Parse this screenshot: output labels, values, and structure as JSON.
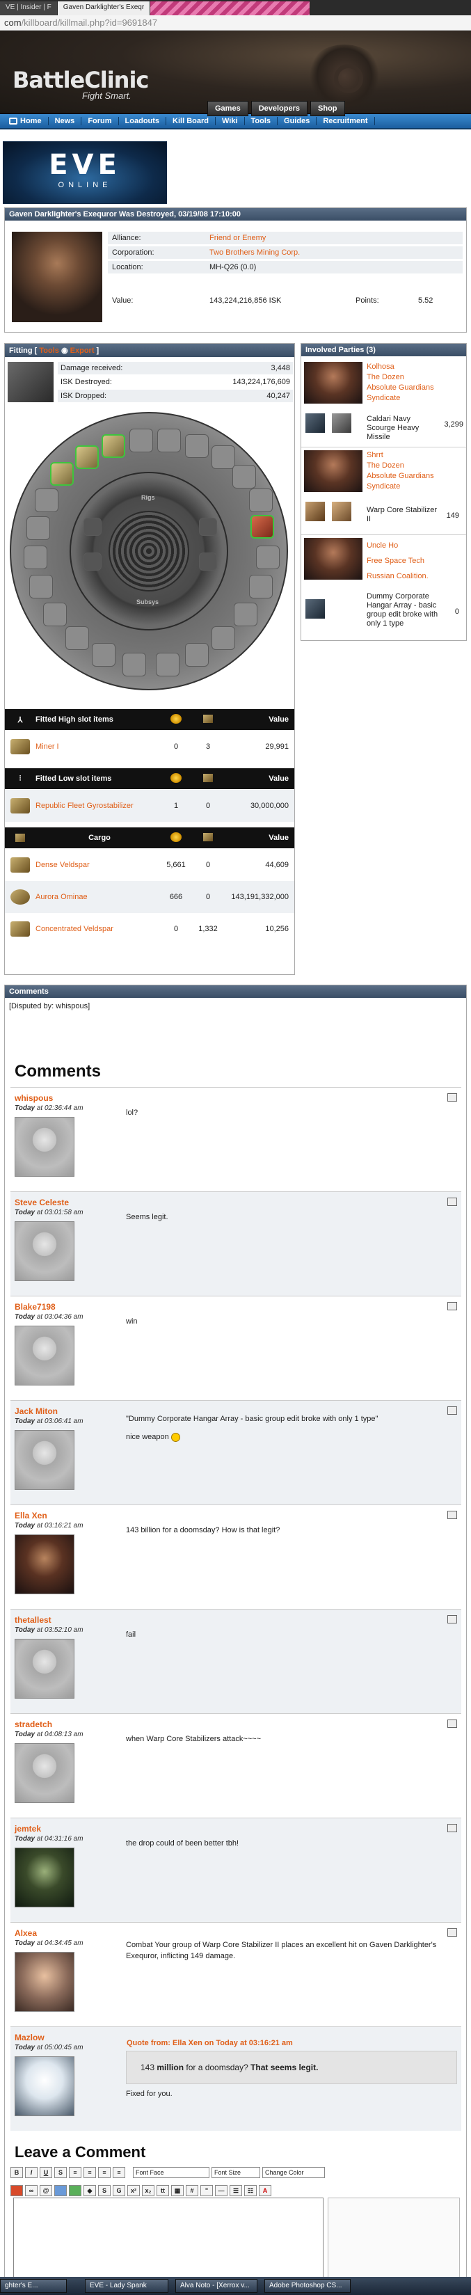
{
  "browser": {
    "tabs": [
      "VE | Insider | F",
      "Gaven Darklighter's Exeqr",
      ""
    ],
    "url_prefix": "com",
    "url_path": "/killboard/killmail.php?id=9691847"
  },
  "site": {
    "logo": "BattleClinic",
    "tagline": "Fight Smart.",
    "topnav": [
      "Games",
      "Developers",
      "Shop"
    ],
    "menu": [
      "Home",
      "News",
      "Forum",
      "Loadouts",
      "Kill Board",
      "Wiki",
      "Tools",
      "Guides",
      "Recruitment"
    ],
    "banner_title": "EVE",
    "banner_sub": "ONLINE"
  },
  "victim": {
    "heading": "Gaven Darklighter's Exequror Was Destroyed, 03/19/08 17:10:00",
    "rows": [
      {
        "label": "Alliance:",
        "value": "Friend or Enemy"
      },
      {
        "label": "Corporation:",
        "value": "Two Brothers Mining Corp."
      },
      {
        "label": "Location:",
        "value": "MH-Q26 (0.0)"
      }
    ],
    "value_label": "Value:",
    "value": "143,224,216,856 ISK",
    "points_label": "Points:",
    "points": "5.52"
  },
  "fitting": {
    "heading": "Fitting [",
    "heading_links": [
      "Tools",
      "Export"
    ],
    "damage_rows": [
      {
        "label": "Damage received:",
        "value": "3,448"
      },
      {
        "label": "ISK Destroyed:",
        "value": "143,224,176,609"
      },
      {
        "label": "ISK Dropped:",
        "value": "40,247"
      }
    ],
    "wheel_labels": [
      "Rigs",
      "Subsys"
    ],
    "sections": [
      {
        "title": "Fitted High slot items",
        "value_header": "Value",
        "items": [
          {
            "name": "Miner I",
            "a": "0",
            "b": "3",
            "value": "29,991"
          }
        ]
      },
      {
        "title": "Fitted Low slot items",
        "value_header": "Value",
        "items": [
          {
            "name": "Republic Fleet Gyrostabilizer",
            "a": "1",
            "b": "0",
            "value": "30,000,000"
          }
        ]
      },
      {
        "title": "Cargo",
        "value_header": "Value",
        "items": [
          {
            "name": "Dense Veldspar",
            "a": "5,661",
            "b": "0",
            "value": "44,609"
          },
          {
            "name": "Aurora Ominae",
            "a": "666",
            "b": "0",
            "value": "143,191,332,000"
          },
          {
            "name": "Concentrated Veldspar",
            "a": "0",
            "b": "1,332",
            "value": "10,256"
          }
        ]
      }
    ]
  },
  "involved": {
    "heading": "Involved Parties (3)",
    "parties": [
      {
        "name": "Kolhosa",
        "corp": "The Dozen",
        "alliance": "Absolute Guardians Syndicate",
        "ship": "Caldari Navy Scourge Heavy Missile",
        "damage": "3,299"
      },
      {
        "name": "Shrrt",
        "corp": "The Dozen",
        "alliance": "Absolute Guardians Syndicate",
        "ship": "Warp Core Stabilizer II",
        "damage": "149"
      },
      {
        "name": "Uncle Ho",
        "corp": "Free Space Tech",
        "alliance": "Russian Coalition.",
        "ship": "Dummy Corporate Hangar Array - basic group edit broke with only 1 type",
        "damage": "0"
      }
    ]
  },
  "comments": {
    "panel_heading": "Comments",
    "disputed": "[Disputed by: whispous]",
    "title": "Comments",
    "items": [
      {
        "name": "whispous",
        "day": "Today",
        "time": "at 02:36:44 am",
        "text": "lol?"
      },
      {
        "name": "Steve Celeste",
        "day": "Today",
        "time": "at 03:01:58 am",
        "text": "Seems legit."
      },
      {
        "name": "Blake7198",
        "day": "Today",
        "time": "at 03:04:36 am",
        "text": "win"
      },
      {
        "name": "Jack Miton",
        "day": "Today",
        "time": "at 03:06:41 am",
        "text": "\"Dummy Corporate Hangar Array - basic group edit broke with only 1 type\"",
        "text2": "nice weapon"
      },
      {
        "name": "Ella Xen",
        "day": "Today",
        "time": "at 03:16:21 am",
        "text": "143 billion for a doomsday? How is that legit?"
      },
      {
        "name": "thetallest",
        "day": "Today",
        "time": "at 03:52:10 am",
        "text": "fail"
      },
      {
        "name": "stradetch",
        "day": "Today",
        "time": "at 04:08:13 am",
        "text": "when Warp Core Stabilizers attack~~~~"
      },
      {
        "name": "jemtek",
        "day": "Today",
        "time": "at 04:31:16 am",
        "text": "the drop could of been better tbh!"
      },
      {
        "name": "Alxea",
        "day": "Today",
        "time": "at 04:34:45 am",
        "text": "Combat Your group of Warp Core Stabilizer II places an excellent hit on Gaven Darklighter's Exequror, inflicting 149 damage."
      },
      {
        "name": "Mazlow",
        "day": "Today",
        "time": "at 05:00:45 am",
        "quote_head": "Quote from: Ella Xen on Today at 03:16:21 am",
        "quote_pre": "143 ",
        "quote_bold1": "million",
        "quote_mid": " for a doomsday? ",
        "quote_bold2": "That seems legit.",
        "text": "Fixed for you."
      }
    ],
    "leave_title": "Leave a Comment",
    "selects": [
      "Font Face",
      "Font Size",
      "Change Color"
    ]
  },
  "taskbar": [
    "ghter's E...",
    "EVE - Lady Spank",
    "Alva Noto - [Xerrox v...",
    "Adobe Photoshop CS..."
  ]
}
